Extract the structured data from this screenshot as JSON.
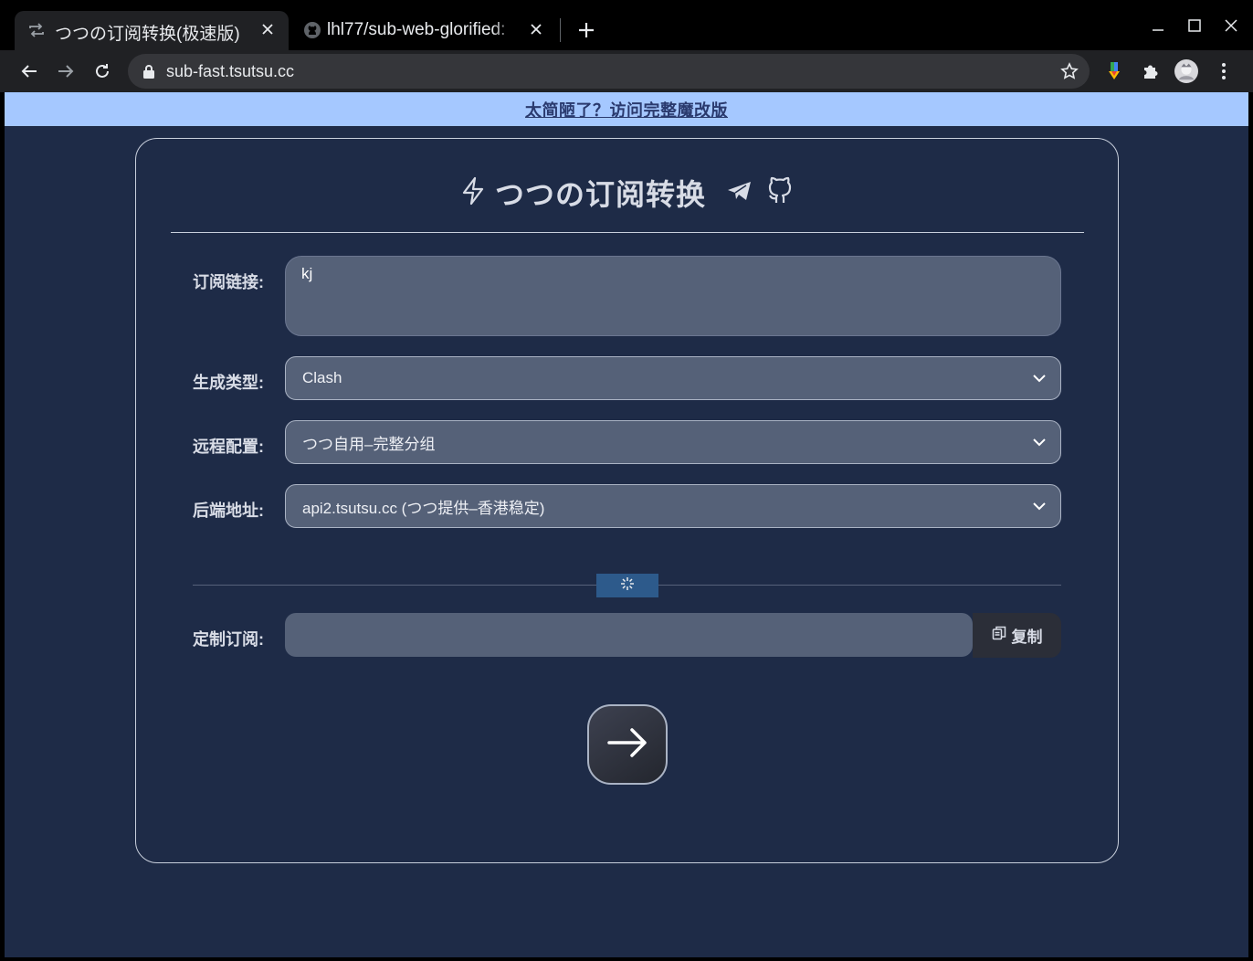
{
  "browser": {
    "tabs": [
      {
        "title": "つつの订阅转换(极速版)",
        "active": true,
        "icon": "repeat-icon"
      },
      {
        "title": "lhl77/sub-web-glorified: ",
        "active": false,
        "icon": "github-icon"
      }
    ],
    "url": "sub-fast.tsutsu.cc"
  },
  "banner": {
    "text": "太简陋了？访问完整魔改版"
  },
  "header": {
    "title": "つつの订阅转换"
  },
  "form": {
    "subscription": {
      "label": "订阅链接:",
      "value": "kj"
    },
    "type": {
      "label": "生成类型:",
      "value": "Clash"
    },
    "remote": {
      "label": "远程配置:",
      "value": "つつ自用–完整分组"
    },
    "backend": {
      "label": "后端地址:",
      "value": "api2.tsutsu.cc (つつ提供–香港稳定)"
    },
    "custom": {
      "label": "定制订阅:",
      "value": "",
      "copy_label": "复制"
    }
  },
  "colors": {
    "page_bg": "#1e2b47",
    "banner_bg": "#a5c8ff",
    "field_bg": "#556178",
    "divider_badge": "#2d5a8b"
  }
}
